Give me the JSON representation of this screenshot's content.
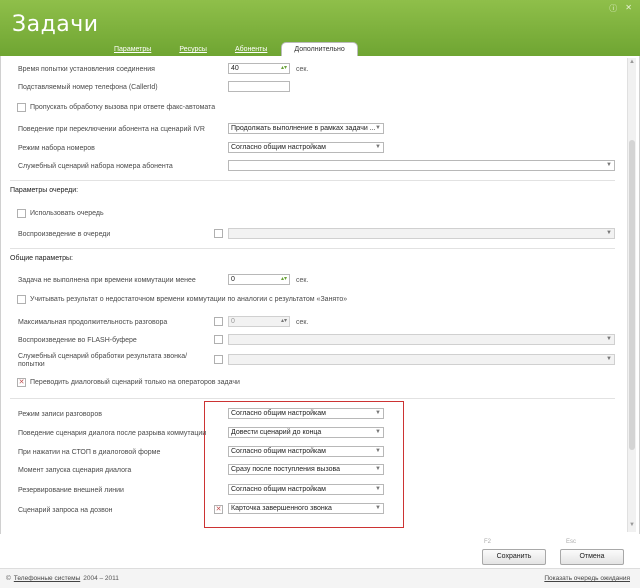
{
  "app": {
    "title": "Задачи"
  },
  "tabs": [
    "Параметры",
    "Ресурсы",
    "Абоненты",
    "Дополнительно"
  ],
  "fields": {
    "dial_attempt_time": {
      "label": "Время попытки установления соединения",
      "value": "40",
      "unit": "сек."
    },
    "caller_id": {
      "label": "Подставляемый номер телефона (CallerId)",
      "value": ""
    },
    "skip_fax": {
      "label": "Пропускать обработку вызова при ответе факс-автомата",
      "checked": false
    },
    "ivr_behavior": {
      "label": "Поведение при переключении абонента на сценарий IVR",
      "value": "Продолжать выполнение в рамках задачи ..."
    },
    "dial_mode": {
      "label": "Режим набора номеров",
      "value": "Согласно общим настройкам"
    },
    "dial_script": {
      "label": "Служебный сценарий набора номера абонента",
      "value": ""
    }
  },
  "queue": {
    "title": "Параметры очереди:",
    "use_queue": {
      "label": "Использовать очередь",
      "checked": false
    },
    "playback": {
      "label": "Воспроизведение в очереди",
      "value": ""
    }
  },
  "general": {
    "title": "Общие параметры:",
    "min_switch_time": {
      "label": "Задача не выполнена при времени коммутации менее",
      "value": "0",
      "unit": "сек."
    },
    "count_busy": {
      "label": "Учитывать результат о недостаточном времени коммутации по аналогии с результатом «Занято»",
      "checked": false
    },
    "max_duration": {
      "label": "Максимальная продолжительность разговора",
      "value": "0",
      "unit": "сек."
    },
    "flash_playback": {
      "label": "Воспроизведение во FLASH-буфере",
      "value": ""
    },
    "result_script": {
      "label": "Служебный сценарий обработки результата звонка/попытки",
      "value": ""
    },
    "dialog_operators": {
      "label": "Переводить диалоговый сценарий только на операторов задачи",
      "checked": true
    }
  },
  "highlighted": {
    "record_mode": {
      "label": "Режим записи разговоров",
      "value": "Согласно общим настройкам"
    },
    "after_break": {
      "label": "Поведение сценария диалога после разрыва коммутации",
      "value": "Довести сценарий до конца"
    },
    "stop_press": {
      "label": "При нажатии на СТОП в диалоговой форме",
      "value": "Согласно общим настройкам"
    },
    "launch_moment": {
      "label": "Момент запуска сценария диалога",
      "value": "Сразу после поступления вызова"
    },
    "line_reserve": {
      "label": "Резервирование внешней линии",
      "value": "Согласно общим настройкам"
    },
    "callback_script": {
      "label": "Сценарий запроса на дозвон",
      "value": "Карточка завершенного звонка",
      "checked": true
    }
  },
  "buttons": {
    "save": "Сохранить",
    "cancel": "Отмена",
    "save_key": "F2",
    "cancel_key": "Esc"
  },
  "status": {
    "company": "Телефонные системы",
    "years": "2004 – 2011",
    "queue_link": "Показать очередь ожидания"
  }
}
